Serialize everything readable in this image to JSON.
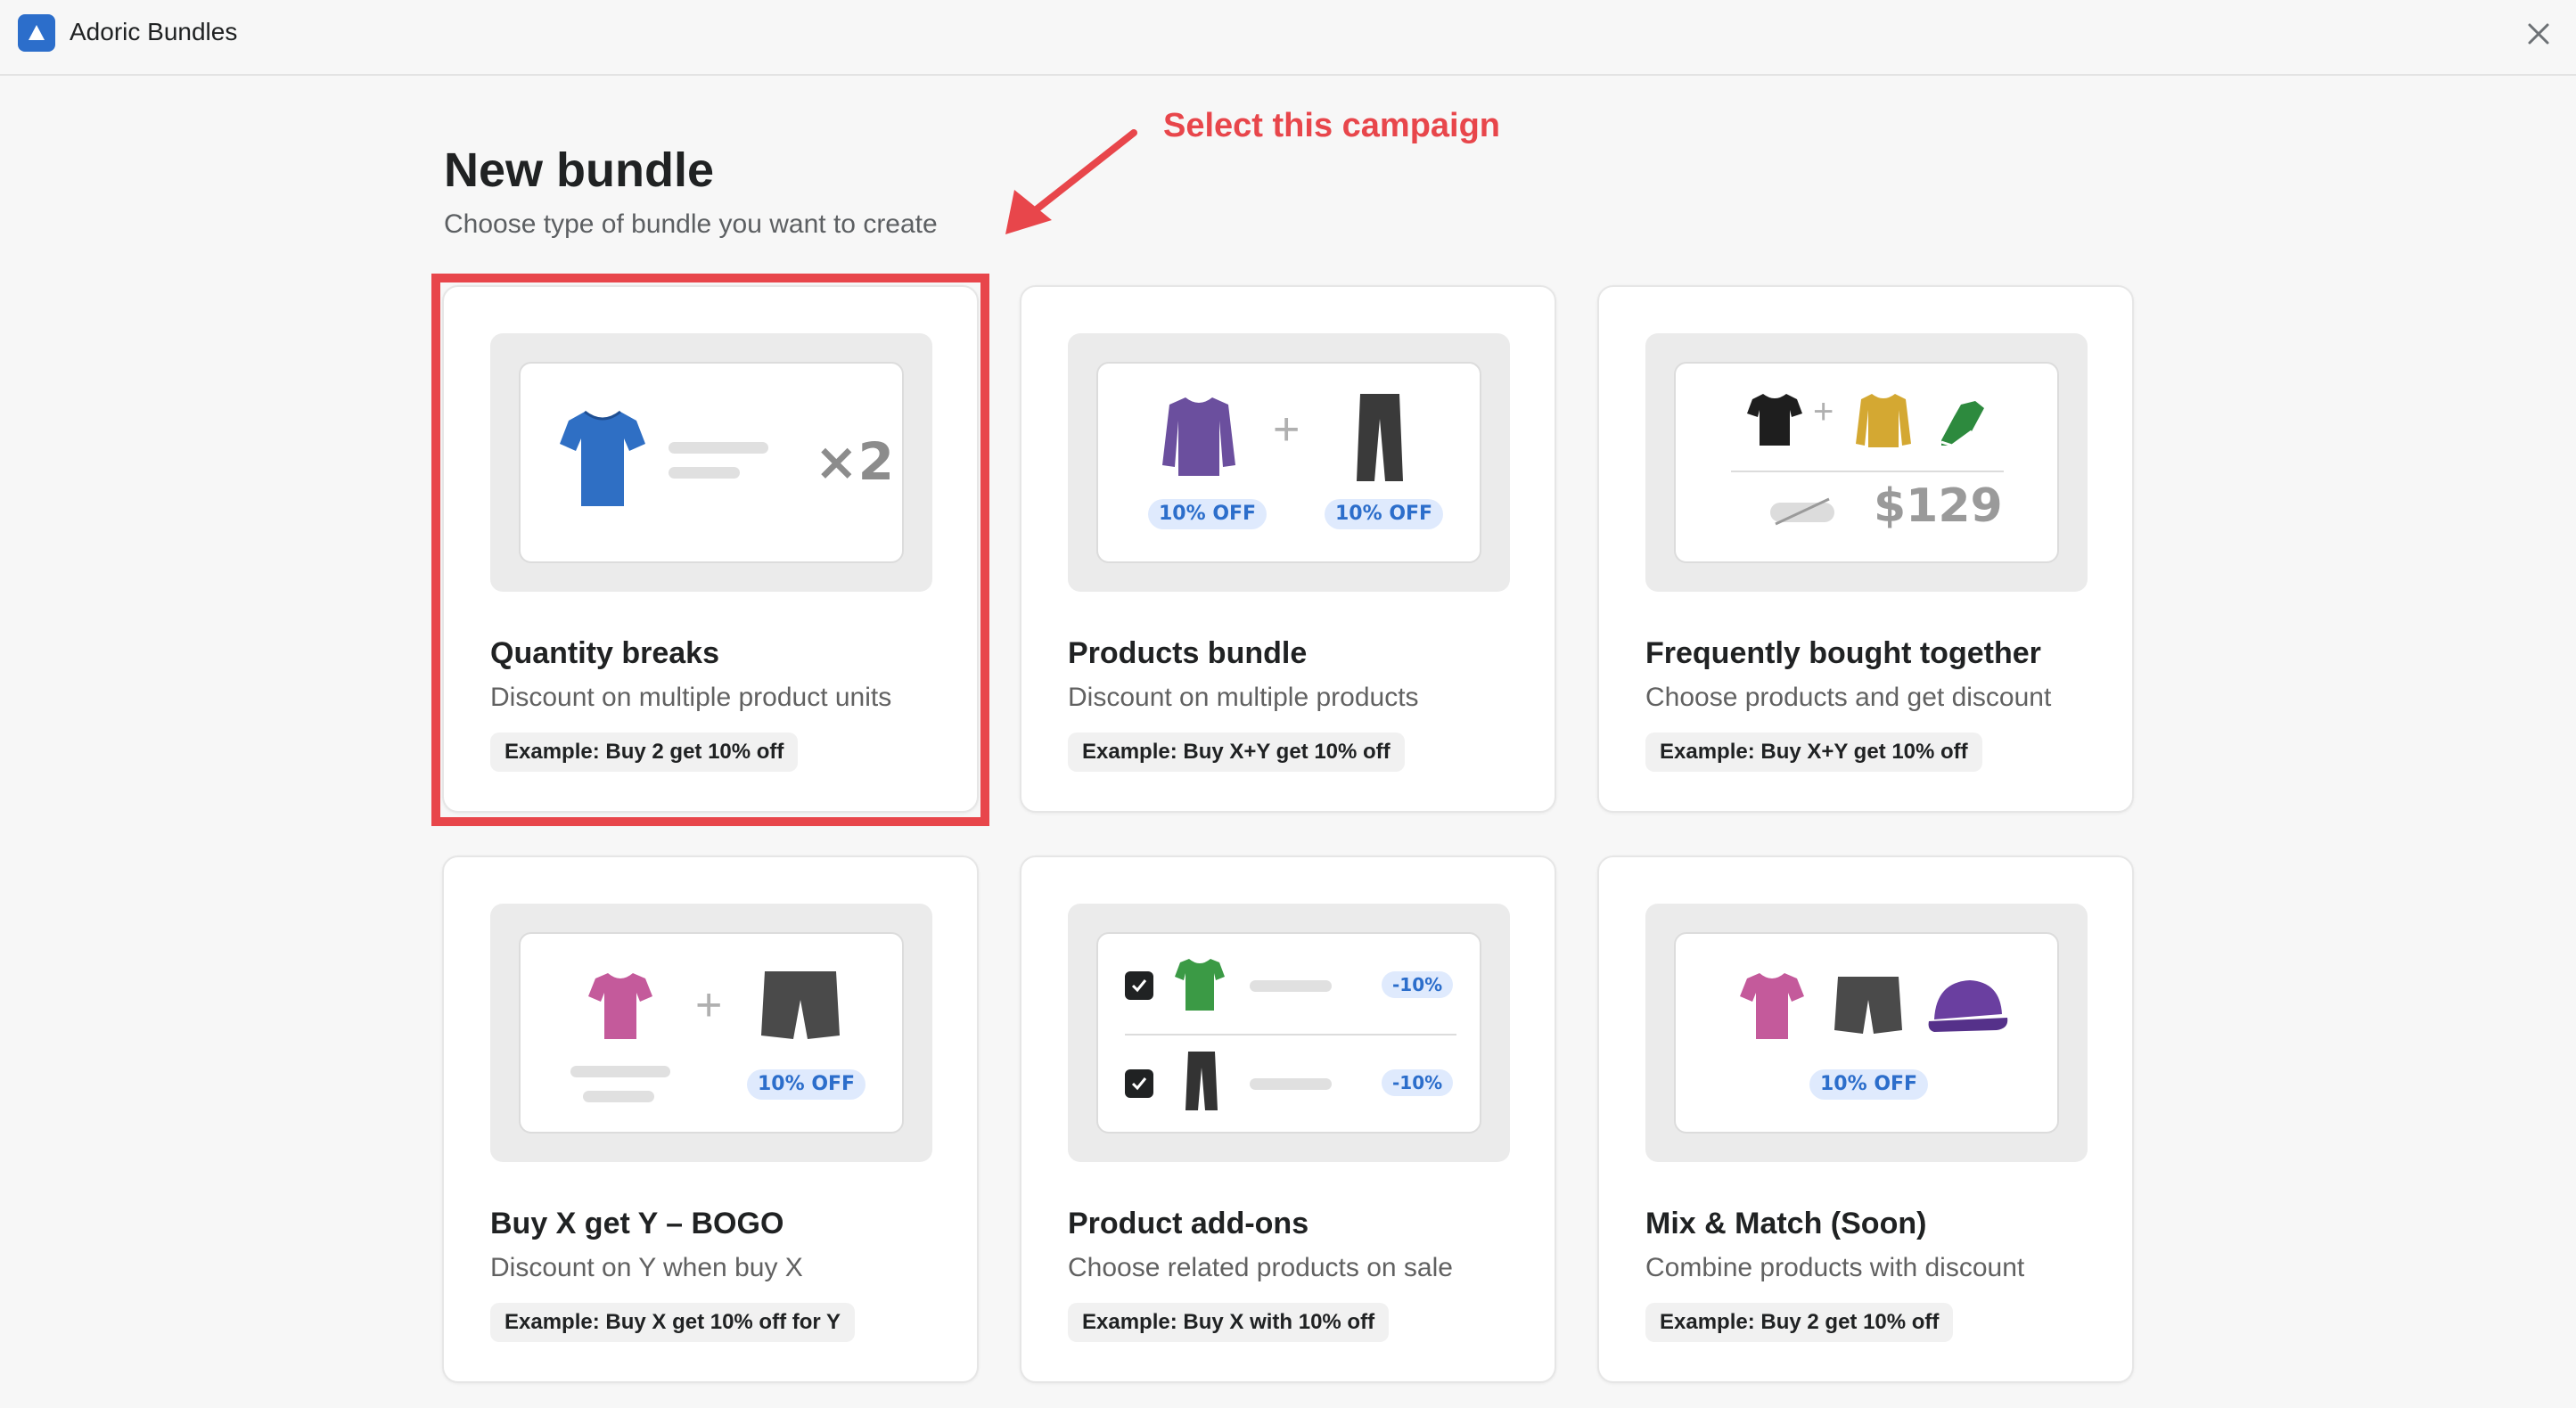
{
  "app": {
    "title": "Adoric Bundles"
  },
  "header": {
    "title": "New bundle",
    "subtitle": "Choose type of bundle you want to create"
  },
  "annotation": {
    "text": "Select this campaign",
    "color": "#e8464b"
  },
  "cards": [
    {
      "title": "Quantity breaks",
      "description": "Discount on multiple product units",
      "example": "Example: Buy 2 get 10% off",
      "preview": {
        "multiplier": "×2"
      },
      "highlighted": true
    },
    {
      "title": "Products bundle",
      "description": "Discount on multiple products",
      "example": "Example: Buy X+Y get 10% off",
      "preview": {
        "badge_a": "10% OFF",
        "badge_b": "10% OFF",
        "plus": "+"
      }
    },
    {
      "title": "Frequently bought together",
      "description": "Choose products and get discount",
      "example": "Example: Buy X+Y get 10% off",
      "preview": {
        "price": "$129",
        "plus": "+"
      }
    },
    {
      "title": "Buy X get Y – BOGO",
      "description": "Discount on Y when buy X",
      "example": "Example: Buy X get 10% off for Y",
      "preview": {
        "badge": "10% OFF",
        "plus": "+"
      }
    },
    {
      "title": "Product add-ons",
      "description": "Choose related products on sale",
      "example": "Example: Buy X with 10% off",
      "preview": {
        "row1_discount": "-10%",
        "row2_discount": "-10%"
      }
    },
    {
      "title": "Mix & Match (Soon)",
      "description": "Combine products with discount",
      "example": "Example: Buy 2 get 10% off",
      "preview": {
        "badge": "10% OFF"
      }
    }
  ],
  "colors": {
    "accent": "#2c6ecb",
    "highlight": "#e8464b",
    "badge_bg": "#dfeafd"
  },
  "icons": [
    "app-logo-icon",
    "close-icon",
    "arrow-icon",
    "checkbox-checked-icon"
  ]
}
